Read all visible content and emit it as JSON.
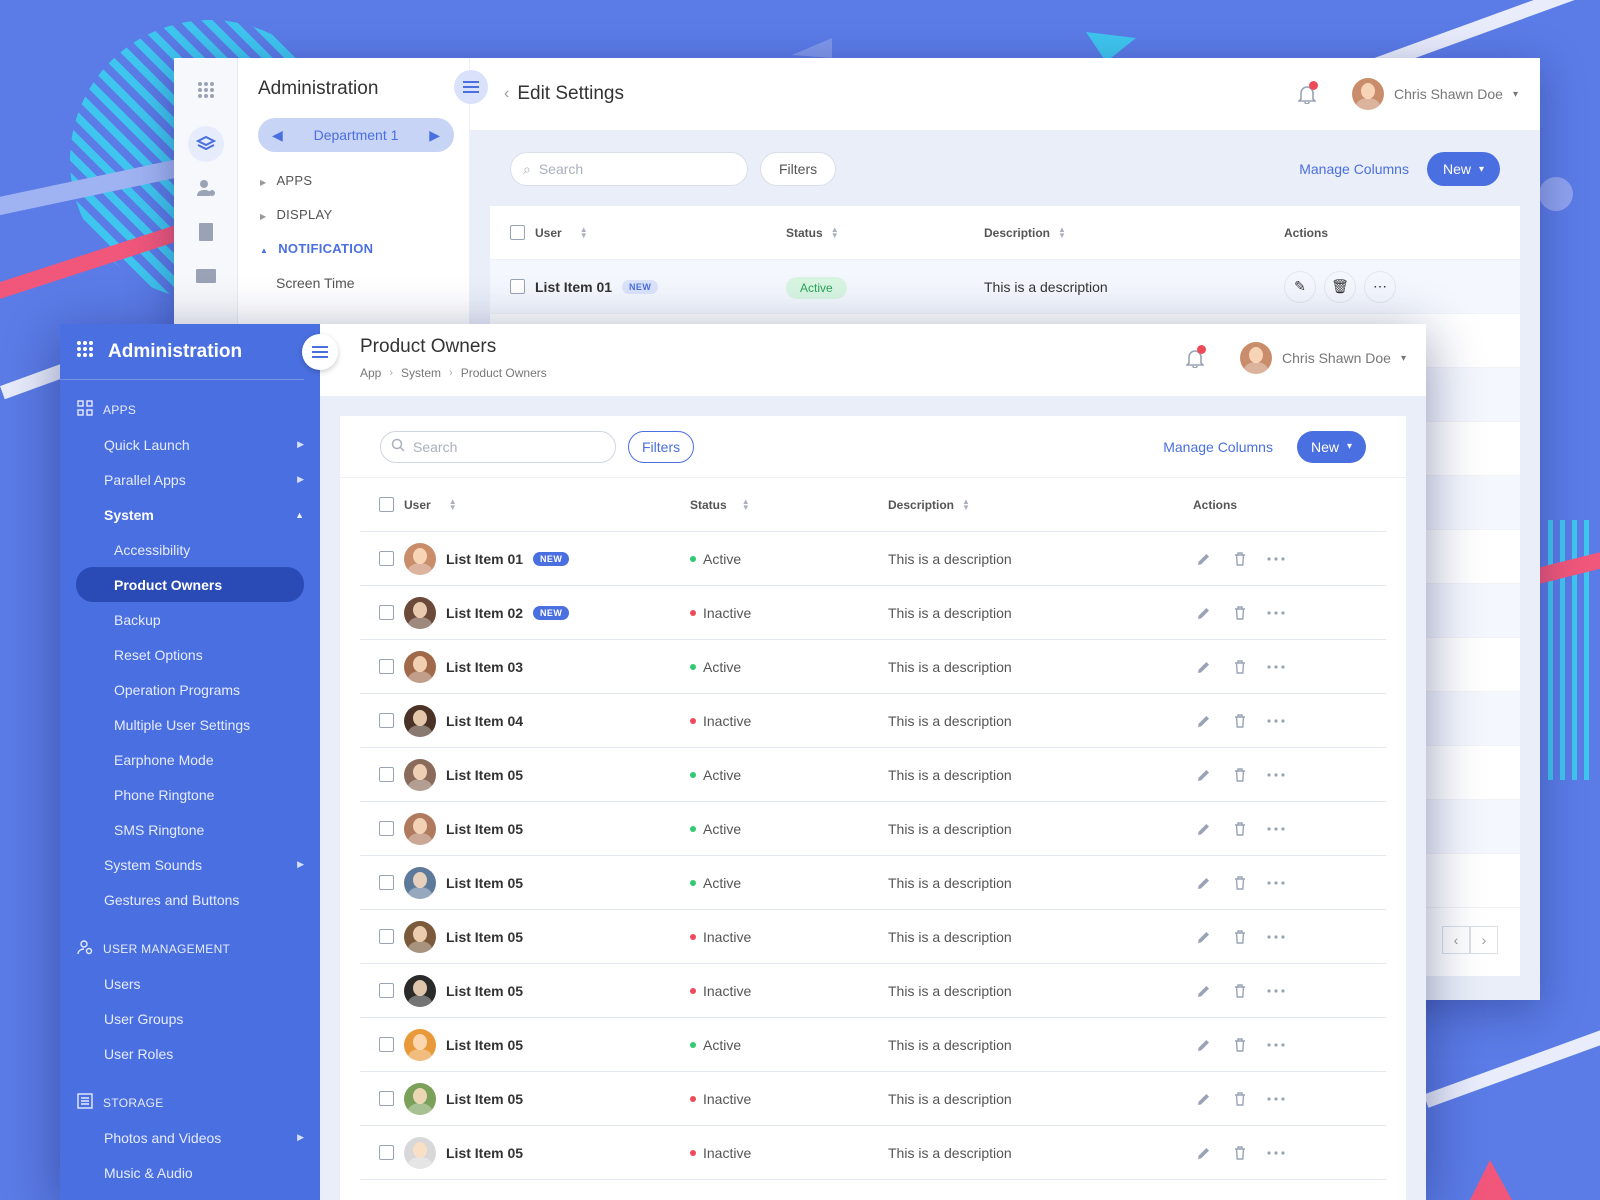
{
  "colors": {
    "accent": "#4a6fe0",
    "active": "#2ecc71",
    "inactive": "#ef4a5a",
    "background": "#5b7be6"
  },
  "back_window": {
    "title": "Administration",
    "department": "Department 1",
    "tree": [
      {
        "label": "APPS",
        "state": "collapsed"
      },
      {
        "label": "DISPLAY",
        "state": "collapsed"
      },
      {
        "label": "NOTIFICATION",
        "state": "expanded"
      },
      {
        "label": "Screen Time",
        "state": "child"
      }
    ],
    "rail_icons": [
      "grid-icon",
      "layers-icon",
      "user-settings-icon",
      "document-icon",
      "mail-icon"
    ],
    "page_title": "Edit Settings",
    "user_name": "Chris Shawn Doe",
    "search_placeholder": "Search",
    "filters_label": "Filters",
    "manage_columns": "Manage Columns",
    "new_label": "New",
    "columns": [
      "User",
      "Status",
      "Description",
      "Actions"
    ],
    "rows": [
      {
        "name": "List Item 01",
        "badge": "NEW",
        "status": "Active",
        "description": "This is a description"
      }
    ]
  },
  "front_window": {
    "title": "Administration",
    "sidebar": {
      "apps_header": "APPS",
      "apps_items": [
        {
          "label": "Quick Launch",
          "arrow": "right"
        },
        {
          "label": "Parallel Apps",
          "arrow": "right"
        },
        {
          "label": "System",
          "arrow": "up",
          "bold": true
        }
      ],
      "system_children": [
        "Accessibility",
        "Product Owners",
        "Backup",
        "Reset Options",
        "Operation Programs",
        "Multiple User Settings",
        "Earphone Mode",
        "Phone Ringtone",
        "SMS Ringtone"
      ],
      "selected": "Product Owners",
      "more_items": [
        {
          "label": "System Sounds",
          "arrow": "right"
        },
        {
          "label": "Gestures and Buttons",
          "arrow": ""
        }
      ],
      "user_mgmt_header": "USER MANAGEMENT",
      "user_mgmt_items": [
        "Users",
        "User Groups",
        "User Roles"
      ],
      "storage_header": "STORAGE",
      "storage_items": [
        {
          "label": "Photos and Videos",
          "arrow": "right"
        },
        {
          "label": "Music & Audio",
          "arrow": ""
        }
      ]
    },
    "page_title": "Product Owners",
    "breadcrumb": [
      "App",
      "System",
      "Product Owners"
    ],
    "user_name": "Chris Shawn Doe",
    "search_placeholder": "Search",
    "filters_label": "Filters",
    "manage_columns": "Manage Columns",
    "new_label": "New",
    "columns": [
      "User",
      "Status",
      "Description",
      "Actions"
    ],
    "rows": [
      {
        "name": "List Item 01",
        "badge": "NEW",
        "status": "Active",
        "description": "This is a description",
        "avatar_color": "#c98d6b"
      },
      {
        "name": "List Item 02",
        "badge": "NEW",
        "status": "Inactive",
        "description": "This is a description",
        "avatar_color": "#6b4a3a"
      },
      {
        "name": "List Item 03",
        "badge": "",
        "status": "Active",
        "description": "This is a description",
        "avatar_color": "#a06a4a"
      },
      {
        "name": "List Item 04",
        "badge": "",
        "status": "Inactive",
        "description": "This is a description",
        "avatar_color": "#4a3226"
      },
      {
        "name": "List Item 05",
        "badge": "",
        "status": "Active",
        "description": "This is a description",
        "avatar_color": "#8a6a5a"
      },
      {
        "name": "List Item 05",
        "badge": "",
        "status": "Active",
        "description": "This is a description",
        "avatar_color": "#b07a5e"
      },
      {
        "name": "List Item 05",
        "badge": "",
        "status": "Active",
        "description": "This is a description",
        "avatar_color": "#5e7a9a"
      },
      {
        "name": "List Item 05",
        "badge": "",
        "status": "Inactive",
        "description": "This is a description",
        "avatar_color": "#7a5a3a"
      },
      {
        "name": "List Item 05",
        "badge": "",
        "status": "Inactive",
        "description": "This is a description",
        "avatar_color": "#2a2a2a"
      },
      {
        "name": "List Item 05",
        "badge": "",
        "status": "Active",
        "description": "This is a description",
        "avatar_color": "#e89a3a"
      },
      {
        "name": "List Item 05",
        "badge": "",
        "status": "Inactive",
        "description": "This is a description",
        "avatar_color": "#7aa05a"
      },
      {
        "name": "List Item 05",
        "badge": "",
        "status": "Inactive",
        "description": "This is a description",
        "avatar_color": "#d8d8d8"
      }
    ]
  }
}
